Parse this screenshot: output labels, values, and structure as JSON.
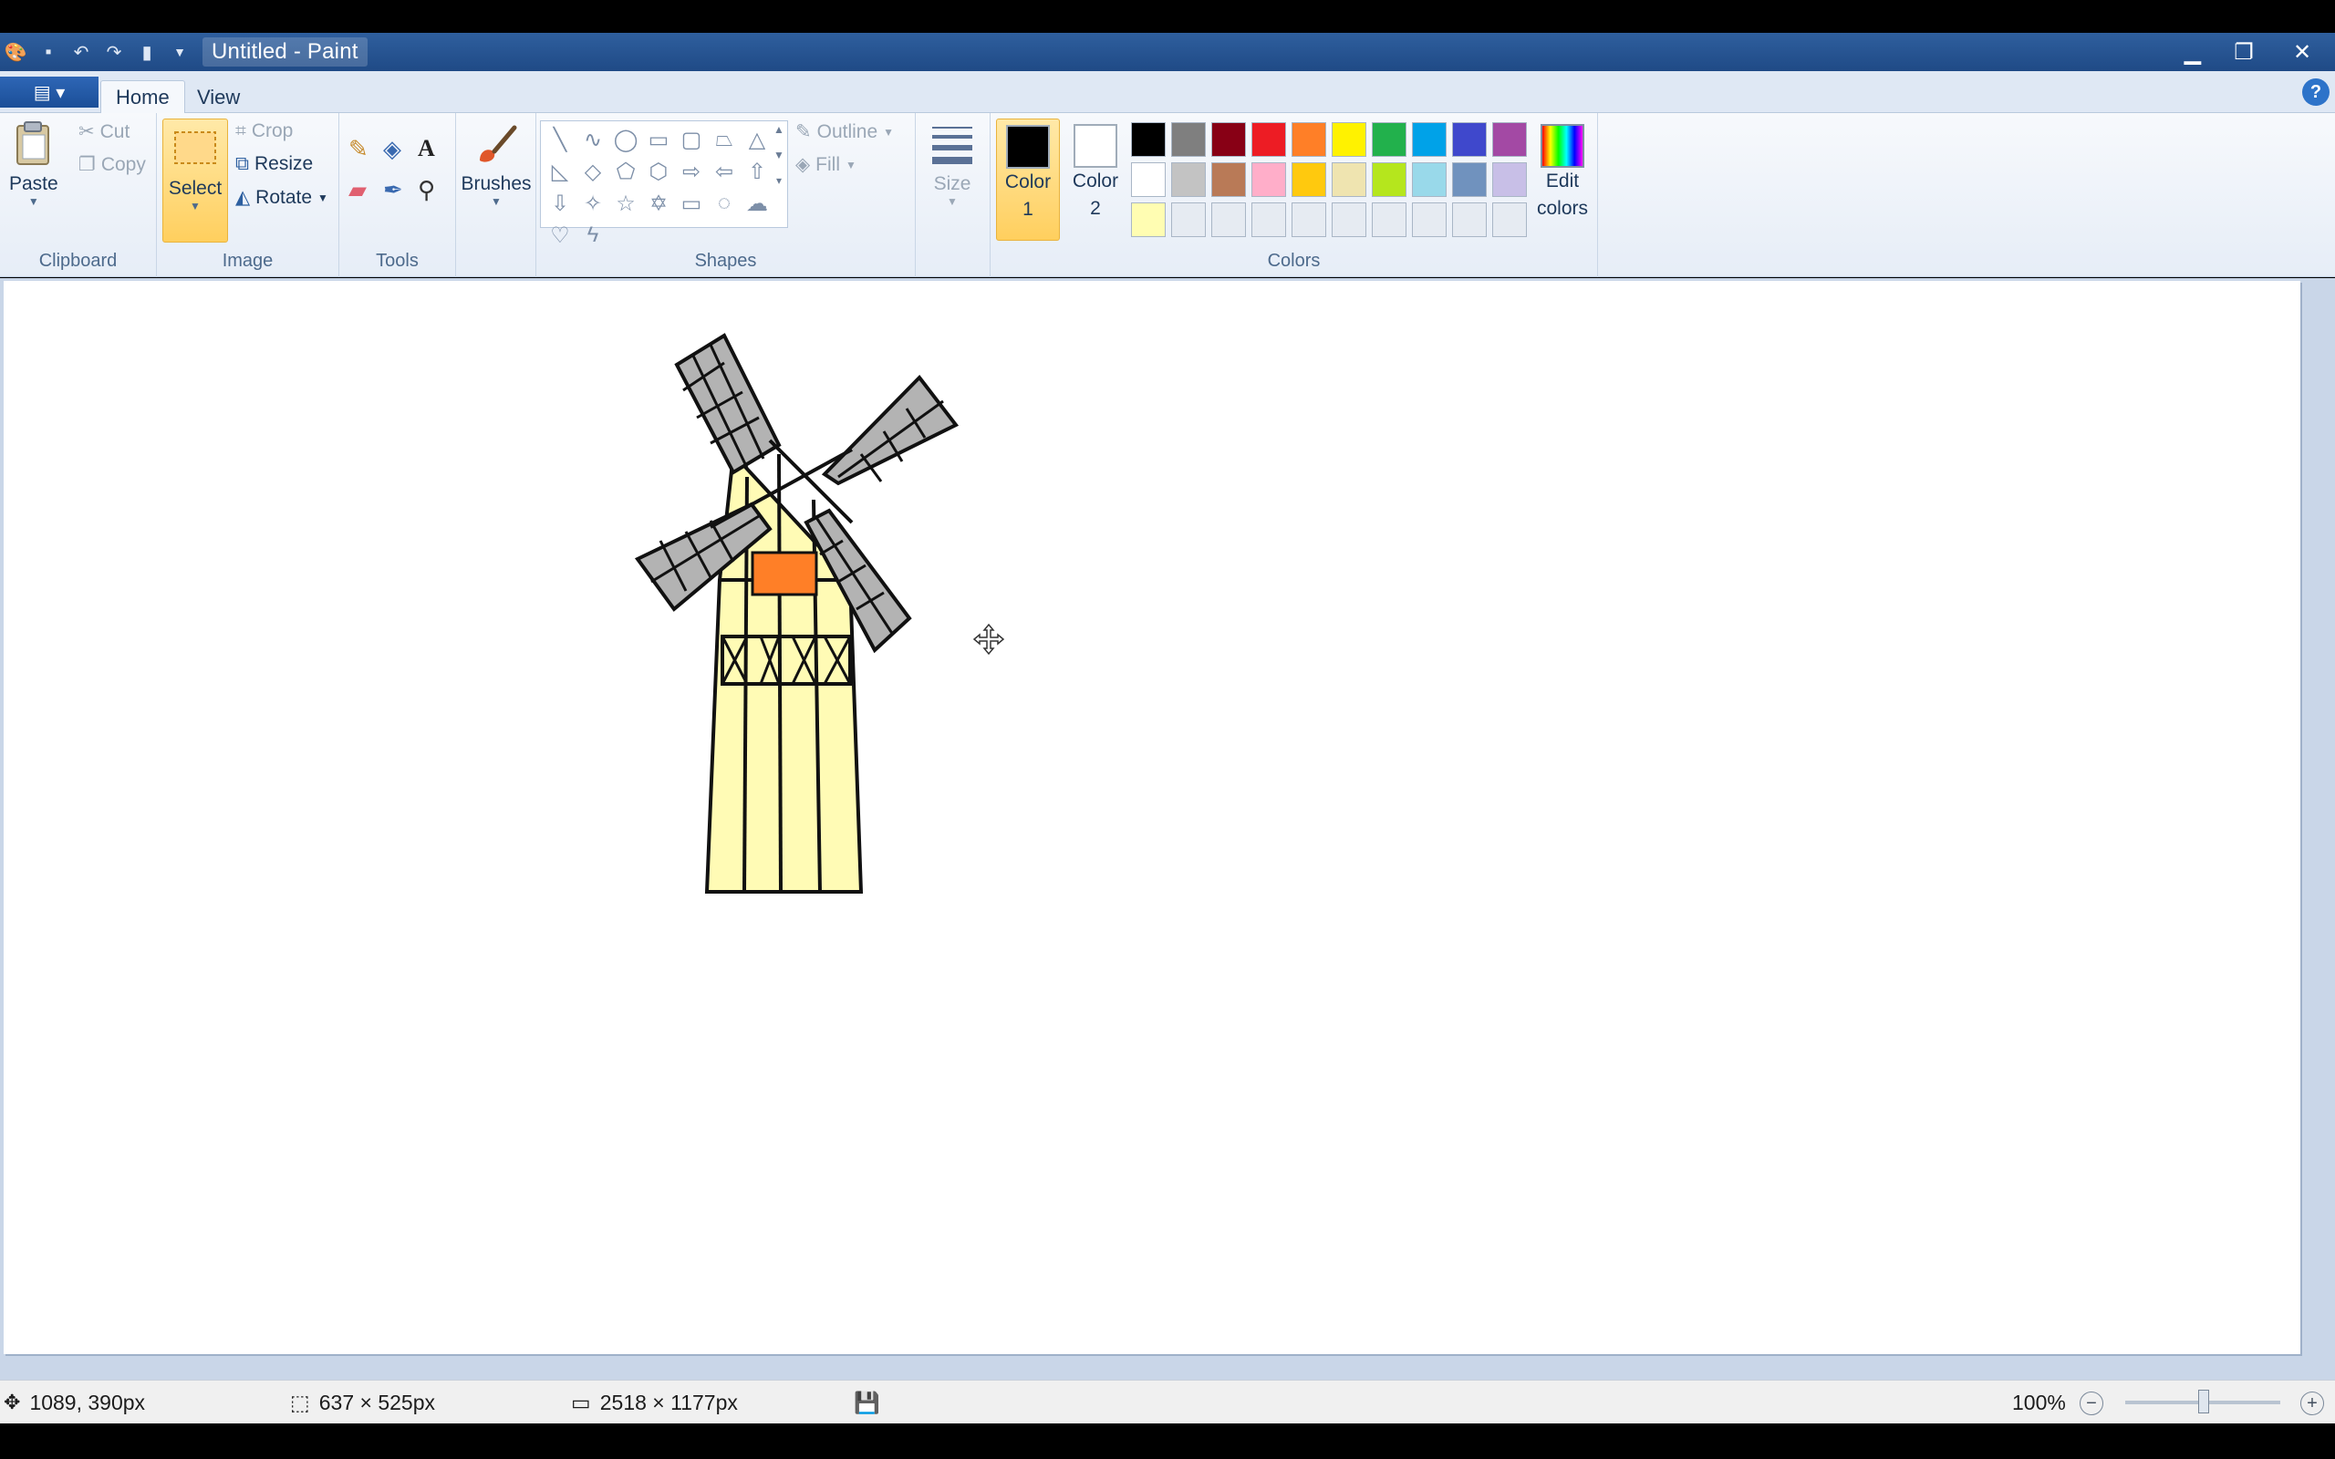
{
  "window": {
    "title": "Untitled - Paint"
  },
  "tabs": [
    {
      "label": "Home"
    },
    {
      "label": "View"
    }
  ],
  "clipboard": {
    "group_label": "Clipboard",
    "paste": "Paste",
    "cut": "Cut",
    "copy": "Copy"
  },
  "image": {
    "group_label": "Image",
    "select": "Select",
    "crop": "Crop",
    "resize": "Resize",
    "rotate": "Rotate"
  },
  "tools": {
    "group_label": "Tools"
  },
  "brushes": {
    "label": "Brushes"
  },
  "shapes": {
    "group_label": "Shapes",
    "outline": "Outline",
    "fill": "Fill"
  },
  "size": {
    "label": "Size"
  },
  "colors": {
    "group_label": "Colors",
    "color1_label": "Color",
    "color1_num": "1",
    "color2_label": "Color",
    "color2_num": "2",
    "edit_label": "Edit",
    "edit_label2": "colors",
    "color1": "#000000",
    "color2": "#ffffff",
    "palette_row1": [
      "#000000",
      "#7f7f7f",
      "#880015",
      "#ed1c24",
      "#ff7f27",
      "#fff200",
      "#22b14c",
      "#00a2e8",
      "#3f48cc",
      "#a349a4"
    ],
    "palette_row2": [
      "#ffffff",
      "#c3c3c3",
      "#b97a57",
      "#ffaec9",
      "#ffc90e",
      "#efe4b0",
      "#b5e61d",
      "#99d9ea",
      "#7092be",
      "#c8bfe7"
    ],
    "palette_row3": [
      "#fffdb2",
      "#e6ebf2",
      "#e6ebf2",
      "#e6ebf2",
      "#e6ebf2",
      "#e6ebf2",
      "#e6ebf2",
      "#e6ebf2",
      "#e6ebf2",
      "#e6ebf2"
    ]
  },
  "status": {
    "cursor_pos": "1089, 390px",
    "selection_size": "637 × 525px",
    "image_size": "2518 × 1177px",
    "zoom": "100%"
  }
}
